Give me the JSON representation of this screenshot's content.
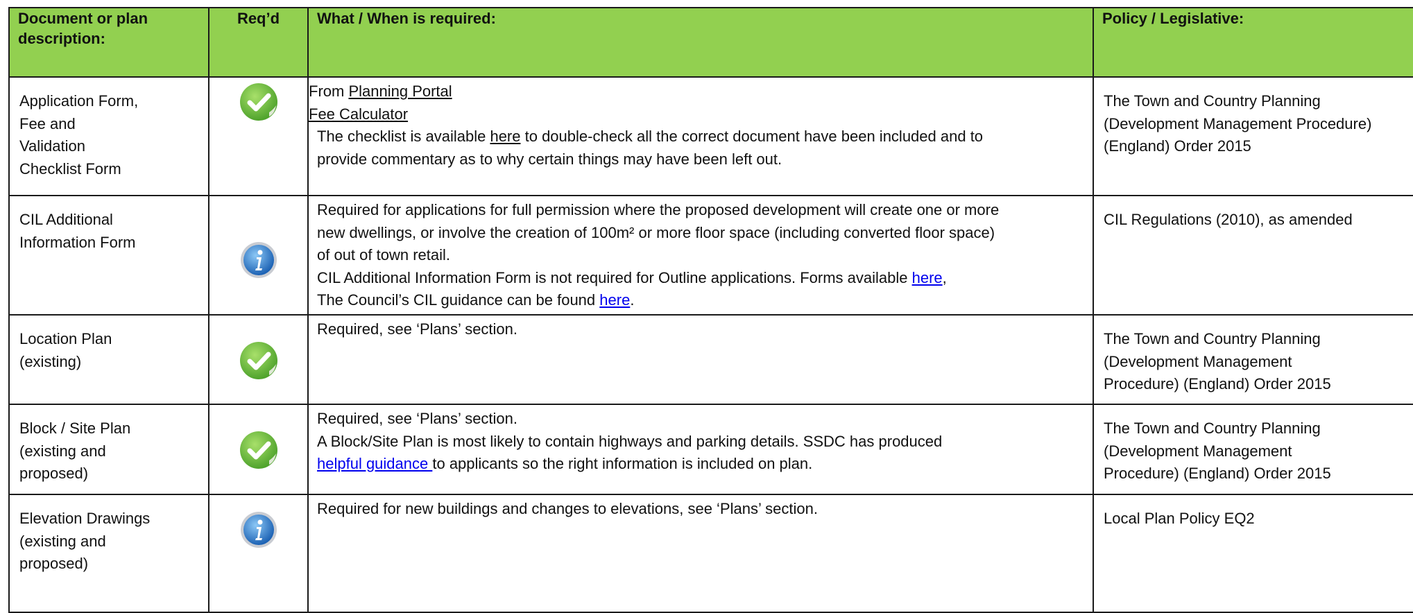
{
  "header": {
    "col1": "Document or plan description:",
    "col2": "Req’d",
    "col3": "What / When is required:",
    "col4": "Policy / Legislative:"
  },
  "rows": [
    {
      "description_lines": [
        "Application Form,",
        "Fee and",
        "Validation",
        "Checklist Form"
      ],
      "req_icon": "green-check-icon",
      "what": {
        "from_prefix": "From ",
        "planning_portal": "Planning Portal",
        "fee_calculator": "Fee Calculator",
        "checklist_pre": "The checklist is available ",
        "checklist_link": "here",
        "checklist_post": " to double-check all the correct document have been included and to",
        "checklist_line2": "provide commentary as to why certain things may have been left out."
      },
      "policy_lines": [
        "The Town and Country Planning",
        "(Development Management Procedure)",
        "(England) Order 2015"
      ]
    },
    {
      "description_lines": [
        "CIL Additional",
        "Information Form"
      ],
      "req_icon": "blue-info-icon",
      "what": {
        "line1": "Required for applications for full permission where the proposed development will create  one  or more",
        "line2": "new dwellings, or involve the creation of 100m² or more floor space (including  converted floor space)",
        "line3": "of out of town retail.",
        "line4_pre": "CIL Additional Information Form is not required for Outline applications. Forms available  ",
        "line4_link": "here",
        "line4_post": ",",
        "line5_pre": "The Council’s CIL guidance can be found ",
        "line5_link": "here",
        "line5_post": "."
      },
      "policy_lines": [
        "CIL Regulations (2010), as amended"
      ]
    },
    {
      "description_lines": [
        "Location Plan",
        "(existing)"
      ],
      "req_icon": "green-check-icon",
      "what": {
        "line1": "Required, see ‘Plans’ section."
      },
      "policy_lines": [
        "The Town and Country Planning",
        "(Development Management",
        "Procedure)  (England) Order 2015"
      ]
    },
    {
      "description_lines": [
        "Block / Site Plan",
        "(existing and",
        "proposed)"
      ],
      "req_icon": "green-check-icon",
      "what": {
        "line1": "Required, see ‘Plans’ section.",
        "line2": "A Block/Site Plan is most likely to contain highways and parking details. SSDC has  produced",
        "line3_link": "helpful guidance ",
        "line3_post": "to applicants so the right information is included on plan."
      },
      "policy_lines": [
        "The Town and Country Planning",
        "(Development Management",
        "Procedure)  (England) Order 2015"
      ]
    },
    {
      "description_lines": [
        "Elevation Drawings",
        "(existing and",
        "proposed)"
      ],
      "req_icon": "blue-info-icon",
      "what": {
        "line1": "Required for new buildings and changes to elevations, see ‘Plans’ section."
      },
      "policy_lines": [
        "Local Plan Policy EQ2"
      ]
    }
  ],
  "colors": {
    "header_bg": "#92d050",
    "link": "#0000ee",
    "check_green": "#6cbf3a",
    "info_blue": "#2e7fd0"
  }
}
